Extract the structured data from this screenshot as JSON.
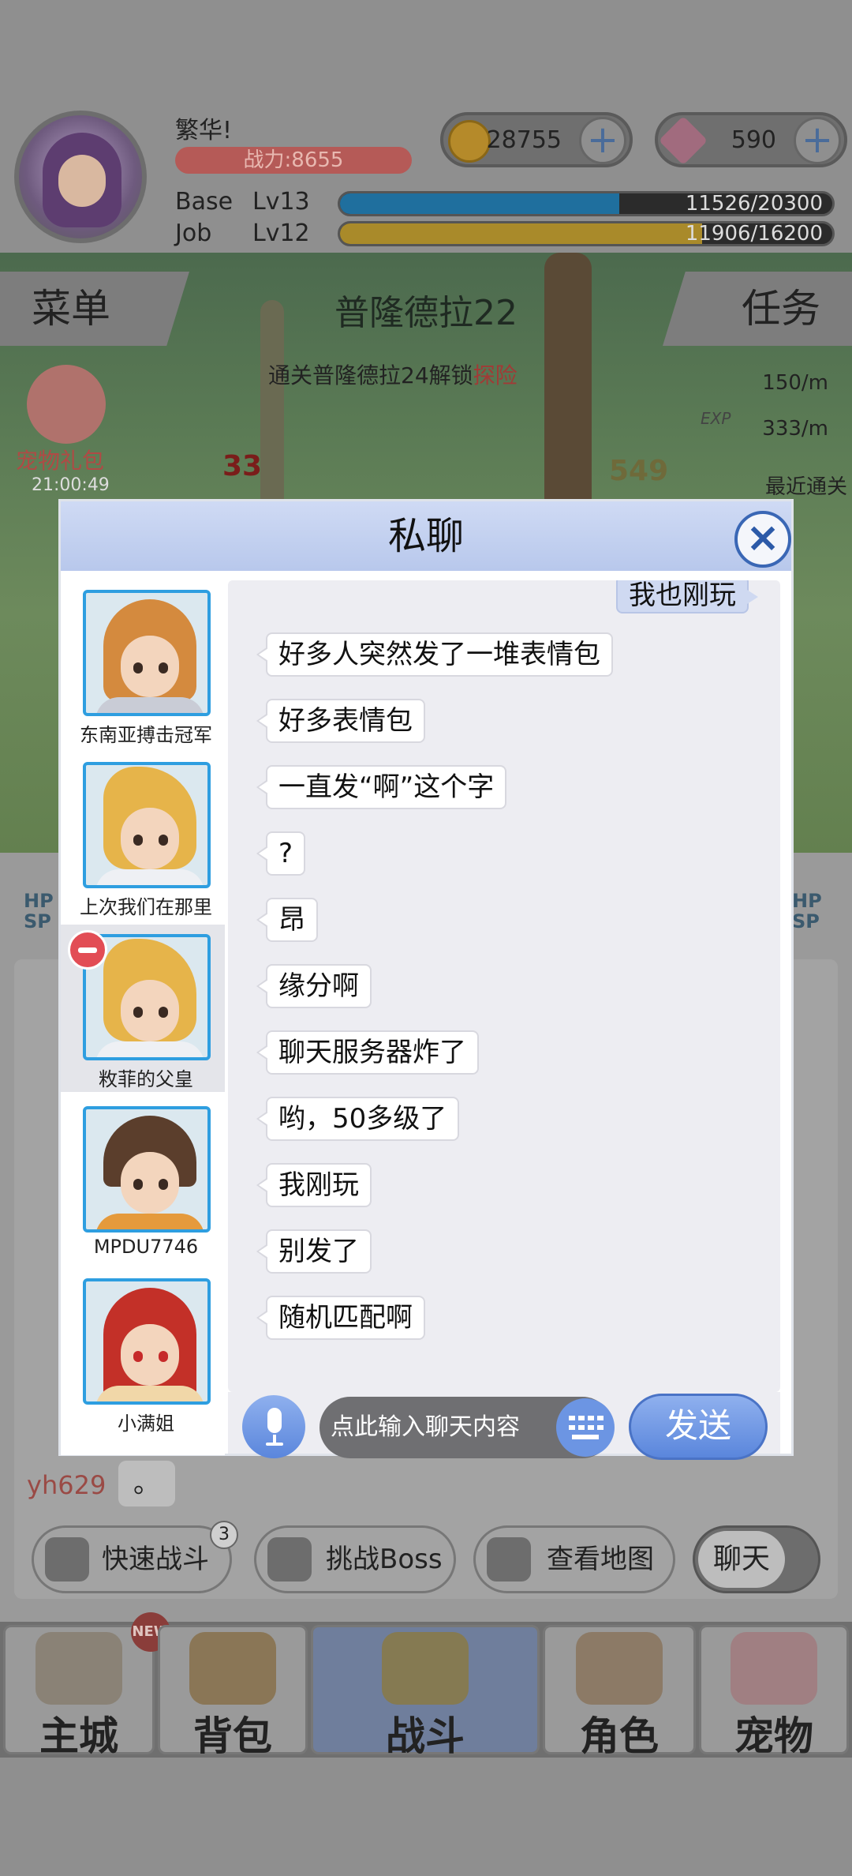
{
  "player": {
    "name": "繁华!",
    "power": "战力:8655",
    "base_label": "Base",
    "base_level": "Lv13",
    "base_exp": "11526/20300",
    "base_progress": 0.568,
    "job_label": "Job",
    "job_level": "Lv12",
    "job_exp": "11906/16200",
    "job_progress": 0.735
  },
  "currency": {
    "gold": "28755",
    "gems": "590"
  },
  "game": {
    "menu_label": "菜单",
    "task_label": "任务",
    "map_name": "普隆德拉22",
    "unlock_hint_main": "通关普隆德拉24解锁",
    "unlock_hint_highlight": "探险",
    "gold_rate": "150/m",
    "exp_rate": "333/m",
    "exp_tag": "EXP",
    "pet_gift_label": "宠物礼包",
    "pet_gift_timer": "21:00:49",
    "damage_1": "33",
    "damage_2": "549",
    "recent_clear": "最近通关",
    "hp_label": "HP",
    "sp_label": "SP",
    "yh_name": "yh629",
    "yh_msg": "。"
  },
  "actions": {
    "quick_battle": "快速战斗",
    "quick_battle_count": "3",
    "challenge_boss": "挑战Boss",
    "view_map": "查看地图",
    "chat": "聊天"
  },
  "tabs": [
    {
      "label": "主城",
      "badge": "NEW"
    },
    {
      "label": "背包"
    },
    {
      "label": "战斗"
    },
    {
      "label": "角色"
    },
    {
      "label": "宠物"
    }
  ],
  "dialog": {
    "title": "私聊",
    "contacts": [
      {
        "name": "东南亚搏击冠军"
      },
      {
        "name": "上次我们在那里"
      },
      {
        "name": "敉菲的父皇"
      },
      {
        "name": "MPDU7746"
      },
      {
        "name": "小满姐"
      }
    ],
    "self_message": "我也刚玩",
    "messages": [
      "好多人突然发了一堆表情包",
      "好多表情包",
      "一直发“啊”这个字",
      "?",
      "昂",
      "缘分啊",
      "聊天服务器炸了",
      "哟，50多级了",
      "我刚玩",
      "别发了",
      "随机匹配啊"
    ],
    "input_placeholder": "点此输入聊天内容",
    "send_label": "发送"
  },
  "colors": {
    "base_bar": "#1f6f9e",
    "job_bar": "#a98a2a",
    "dialog_header": "#c4d2f0",
    "accent_blue": "#5a86dc"
  }
}
